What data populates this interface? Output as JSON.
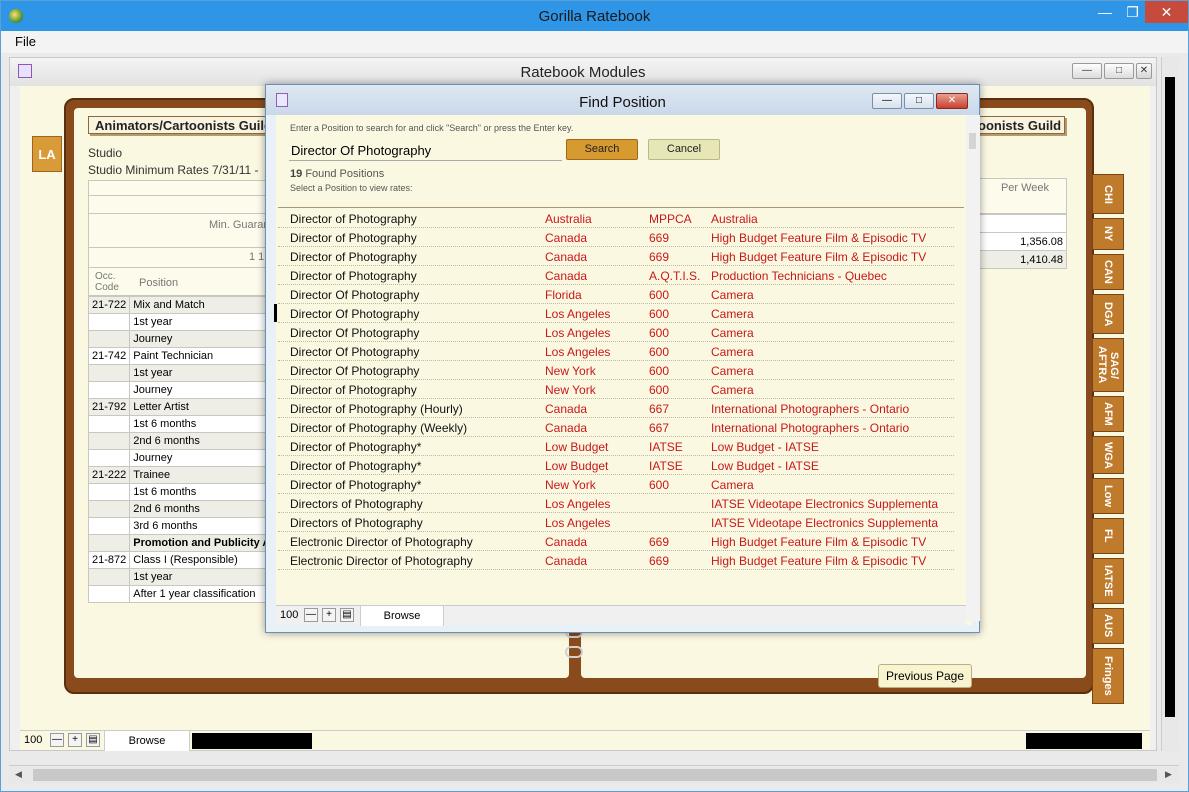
{
  "app": {
    "title": "Gorilla Ratebook",
    "menu": [
      "File"
    ]
  },
  "module_window": {
    "title": "Ratebook Modules"
  },
  "left_tab": "LA",
  "book": {
    "left_guild": "Animators/Cartoonists Guild",
    "right_guild": "oonists Guild",
    "studio": "Studio",
    "rates_label": "Studio Minimum Rates 7/31/11 -",
    "min_guar": "Min. Guarar",
    "one": "1 1",
    "occ_code": "Occ. Code",
    "position": "Position",
    "per_week": "Per Week",
    "rate_rows": [
      {
        "code": "21-722",
        "position": "Mix and Match",
        "style": "g"
      },
      {
        "code": "",
        "position": "1st year",
        "style": "w"
      },
      {
        "code": "",
        "position": "Journey",
        "style": "g"
      },
      {
        "code": "21-742",
        "position": "Paint Technician",
        "style": "w"
      },
      {
        "code": "",
        "position": "1st year",
        "style": "g"
      },
      {
        "code": "",
        "position": "Journey",
        "style": "w"
      },
      {
        "code": "21-792",
        "position": "Letter Artist",
        "style": "g"
      },
      {
        "code": "",
        "position": "1st 6 months",
        "style": "w"
      },
      {
        "code": "",
        "position": "2nd 6 months",
        "style": "g"
      },
      {
        "code": "",
        "position": "Journey",
        "style": "w"
      },
      {
        "code": "21-222",
        "position": "Trainee",
        "style": "g"
      },
      {
        "code": "",
        "position": "1st 6 months",
        "style": "w"
      },
      {
        "code": "",
        "position": "2nd 6 months",
        "style": "g"
      },
      {
        "code": "",
        "position": "3rd 6 months",
        "style": "w"
      },
      {
        "code": "",
        "position": "Promotion and Publicity A",
        "style": "g",
        "bold": true
      },
      {
        "code": "21-872",
        "position": "Class I (Responsible)",
        "style": "w"
      },
      {
        "code": "",
        "position": "1st year",
        "style": "g"
      },
      {
        "code": "",
        "position": "After 1 year classification",
        "style": "w"
      }
    ],
    "week_values": [
      "",
      "1,356.08",
      "1,410.48"
    ],
    "previous_page": "Previous Page"
  },
  "right_tabs": [
    "CHI",
    "NY",
    "CAN",
    "DGA",
    "SAG/ AFTRA",
    "AFM",
    "WGA",
    "Low",
    "FL",
    "IATSE",
    "AUS",
    "Fringes"
  ],
  "status": {
    "zoom": "100",
    "mode": "Browse"
  },
  "dialog": {
    "title": "Find Position",
    "hint": "Enter a Position to search for and click \"Search\" or press the Enter key.",
    "search_value": "Director Of Photography",
    "search_label": "Search",
    "cancel_label": "Cancel",
    "found_count": "19",
    "found_label": "Found Positions",
    "select_hint": "Select a Position to view rates:",
    "results": [
      {
        "position": "Director of Photography",
        "location": "Australia",
        "union": "MPPCA",
        "agreement": "Australia"
      },
      {
        "position": "Director of Photography",
        "location": "Canada",
        "union": "669",
        "agreement": "High Budget Feature Film & Episodic TV"
      },
      {
        "position": "Director of Photography",
        "location": "Canada",
        "union": "669",
        "agreement": "High Budget Feature Film & Episodic TV"
      },
      {
        "position": "Director of Photography",
        "location": "Canada",
        "union": "A.Q.T.I.S.",
        "agreement": "Production Technicians - Quebec"
      },
      {
        "position": "Director Of Photography",
        "location": "Florida",
        "union": "600",
        "agreement": "Camera"
      },
      {
        "position": "Director Of Photography",
        "location": "Los Angeles",
        "union": "600",
        "agreement": "Camera"
      },
      {
        "position": "Director Of Photography",
        "location": "Los Angeles",
        "union": "600",
        "agreement": "Camera"
      },
      {
        "position": "Director Of Photography",
        "location": "Los Angeles",
        "union": "600",
        "agreement": "Camera"
      },
      {
        "position": "Director Of Photography",
        "location": "New York",
        "union": "600",
        "agreement": "Camera"
      },
      {
        "position": "Director of Photography",
        "location": "New York",
        "union": "600",
        "agreement": "Camera"
      },
      {
        "position": "Director of Photography (Hourly)",
        "location": "Canada",
        "union": "667",
        "agreement": "International Photographers - Ontario"
      },
      {
        "position": "Director of Photography (Weekly)",
        "location": "Canada",
        "union": "667",
        "agreement": "International Photographers - Ontario"
      },
      {
        "position": "Director of Photography*",
        "location": "Low Budget",
        "union": "IATSE",
        "agreement": "Low Budget - IATSE"
      },
      {
        "position": "Director of Photography*",
        "location": "Low Budget",
        "union": "IATSE",
        "agreement": "Low Budget - IATSE"
      },
      {
        "position": "Director of Photography*",
        "location": "New York",
        "union": "600",
        "agreement": "Camera"
      },
      {
        "position": "Directors of Photography",
        "location": "Los Angeles",
        "union": "",
        "agreement": "IATSE Videotape Electronics Supplementa"
      },
      {
        "position": "Directors of Photography",
        "location": "Los Angeles",
        "union": "",
        "agreement": "IATSE Videotape Electronics Supplementa"
      },
      {
        "position": "Electronic Director of Photography",
        "location": "Canada",
        "union": "669",
        "agreement": "High Budget Feature Film & Episodic TV"
      },
      {
        "position": "Electronic Director of Photography",
        "location": "Canada",
        "union": "669",
        "agreement": "High Budget Feature Film & Episodic TV"
      }
    ],
    "status": {
      "zoom": "100",
      "mode": "Browse"
    }
  }
}
